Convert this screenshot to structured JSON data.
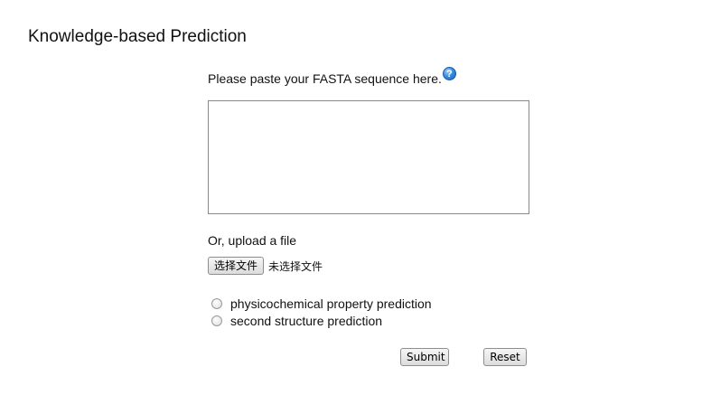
{
  "page": {
    "title": "Knowledge-based Prediction"
  },
  "form": {
    "prompt": "Please paste your FASTA sequence here.",
    "help_icon_glyph": "?",
    "help_icon": "help-question-icon",
    "sequence_value": "",
    "upload_label": "Or, upload a file",
    "choose_file_button": "选择文件",
    "file_status": "未选择文件",
    "prediction_options": [
      {
        "label": "physicochemical property prediction",
        "selected": false
      },
      {
        "label": "second structure prediction",
        "selected": false
      }
    ],
    "submit_label": "Submit",
    "reset_label": "Reset"
  },
  "colors": {
    "help_icon": "#3b8fe0",
    "text": "#111111"
  }
}
